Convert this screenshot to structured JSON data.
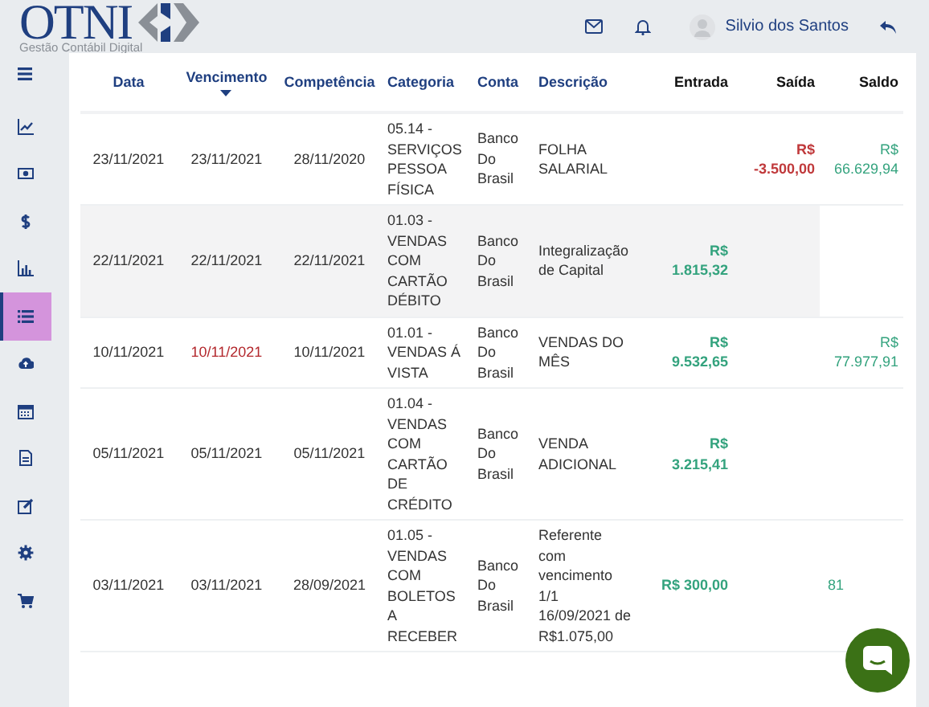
{
  "logo": {
    "name": "OTNI",
    "tagline": "Gestão Contábil Digital"
  },
  "header": {
    "user_name": "Silvio dos Santos"
  },
  "sidebar": {
    "items": [
      {
        "selected": false
      },
      {
        "selected": false
      },
      {
        "selected": false
      },
      {
        "selected": false
      },
      {
        "selected": true
      },
      {
        "selected": false
      },
      {
        "selected": false
      },
      {
        "selected": false
      },
      {
        "selected": false
      },
      {
        "selected": false
      },
      {
        "selected": false
      }
    ]
  },
  "table": {
    "columns": [
      {
        "label": "Data",
        "kind": "text",
        "sorted": false
      },
      {
        "label": "Vencimento",
        "kind": "text",
        "sorted": true
      },
      {
        "label": "Competência",
        "kind": "text",
        "sorted": false
      },
      {
        "label": "Categoria",
        "kind": "text",
        "sorted": false
      },
      {
        "label": "Conta",
        "kind": "text",
        "sorted": false
      },
      {
        "label": "Descrição",
        "kind": "text",
        "sorted": false
      },
      {
        "label": "Entrada",
        "kind": "money",
        "sorted": false
      },
      {
        "label": "Saída",
        "kind": "money",
        "sorted": false
      },
      {
        "label": "Saldo",
        "kind": "money",
        "sorted": false
      }
    ],
    "rows": [
      {
        "data": "23/11/2021",
        "vencimento": "23/11/2021",
        "overdue": false,
        "competencia": "28/11/2020",
        "categoria": "05.14 - SERVIÇOS PESSOA FÍSICA",
        "conta": "Banco Do Brasil",
        "descricao": "FOLHA SALARIAL",
        "saida": "R$ -3.500,00",
        "saldo": "R$ 66.629,94",
        "highlighted": false
      },
      {
        "data": "22/11/2021",
        "vencimento": "22/11/2021",
        "overdue": false,
        "competencia": "22/11/2021",
        "categoria": "01.03 - VENDAS COM CARTÃO DÉBITO",
        "conta": "Banco Do Brasil",
        "descricao": "Integralização de Capital",
        "entrada": "R$ 1.815,32",
        "highlighted": true
      },
      {
        "data": "10/11/2021",
        "vencimento": "10/11/2021",
        "overdue": true,
        "competencia": "10/11/2021",
        "categoria": "01.01 - VENDAS Á VISTA",
        "conta": "Banco Do Brasil",
        "descricao": "VENDAS DO MÊS",
        "entrada": "R$ 9.532,65",
        "saldo": "R$ 77.977,91",
        "highlighted": false
      },
      {
        "data": "05/11/2021",
        "vencimento": "05/11/2021",
        "overdue": false,
        "competencia": "05/11/2021",
        "categoria": "01.04 - VENDAS COM CARTÃO DE CRÉDITO",
        "conta": "Banco Do Brasil",
        "descricao": "VENDA ADICIONAL",
        "entrada": "R$ 3.215,41",
        "highlighted": false
      },
      {
        "data": "03/11/2021",
        "vencimento": "03/11/2021",
        "overdue": false,
        "competencia": "28/09/2021",
        "categoria": "01.05 - VENDAS COM BOLETOS A RECEBER",
        "conta": "Banco Do Brasil",
        "descricao": "Referente com vencimento 1/1 16/09/2021 de R$1.075,00",
        "entrada": "R$ 300,00",
        "saldo": "81",
        "saldo_cut": true,
        "highlighted": false
      }
    ]
  }
}
